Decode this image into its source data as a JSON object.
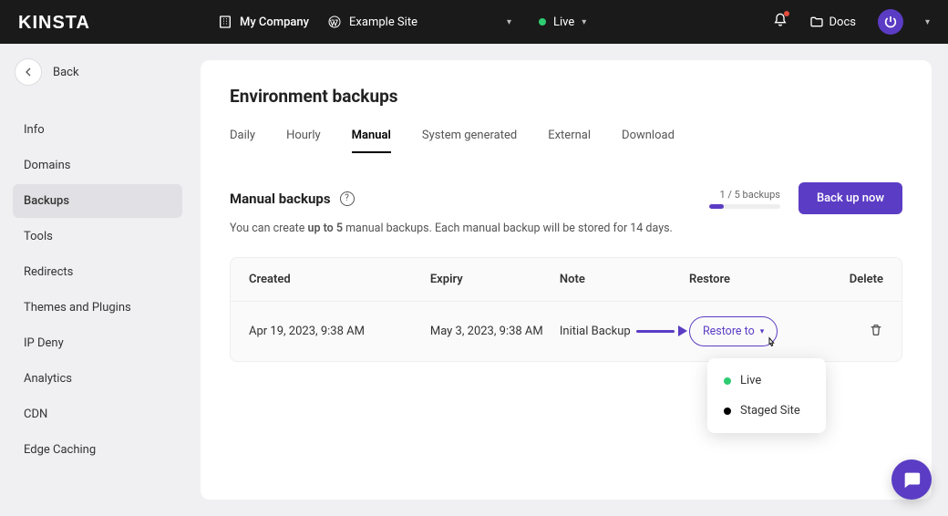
{
  "topbar": {
    "logo": "KINSTA",
    "company": "My Company",
    "site": "Example Site",
    "env": "Live",
    "docs": "Docs"
  },
  "sidebar": {
    "back": "Back",
    "items": [
      {
        "label": "Info"
      },
      {
        "label": "Domains"
      },
      {
        "label": "Backups",
        "active": true
      },
      {
        "label": "Tools"
      },
      {
        "label": "Redirects"
      },
      {
        "label": "Themes and Plugins"
      },
      {
        "label": "IP Deny"
      },
      {
        "label": "Analytics"
      },
      {
        "label": "CDN"
      },
      {
        "label": "Edge Caching"
      }
    ]
  },
  "page": {
    "title": "Environment backups",
    "tabs": [
      {
        "label": "Daily"
      },
      {
        "label": "Hourly"
      },
      {
        "label": "Manual",
        "active": true
      },
      {
        "label": "System generated"
      },
      {
        "label": "External"
      },
      {
        "label": "Download"
      }
    ],
    "section_title": "Manual backups",
    "progress_label": "1 / 5 backups",
    "backup_now": "Back up now",
    "desc_prefix": "You can create ",
    "desc_bold": "up to 5",
    "desc_suffix": " manual backups. Each manual backup will be stored for 14 days.",
    "columns": {
      "created": "Created",
      "expiry": "Expiry",
      "note": "Note",
      "restore": "Restore",
      "delete": "Delete"
    },
    "rows": [
      {
        "created": "Apr 19, 2023, 9:38 AM",
        "expiry": "May 3, 2023, 9:38 AM",
        "note": "Initial Backup",
        "restore_label": "Restore to"
      }
    ],
    "dropdown": {
      "live": "Live",
      "staged": "Staged Site"
    }
  }
}
